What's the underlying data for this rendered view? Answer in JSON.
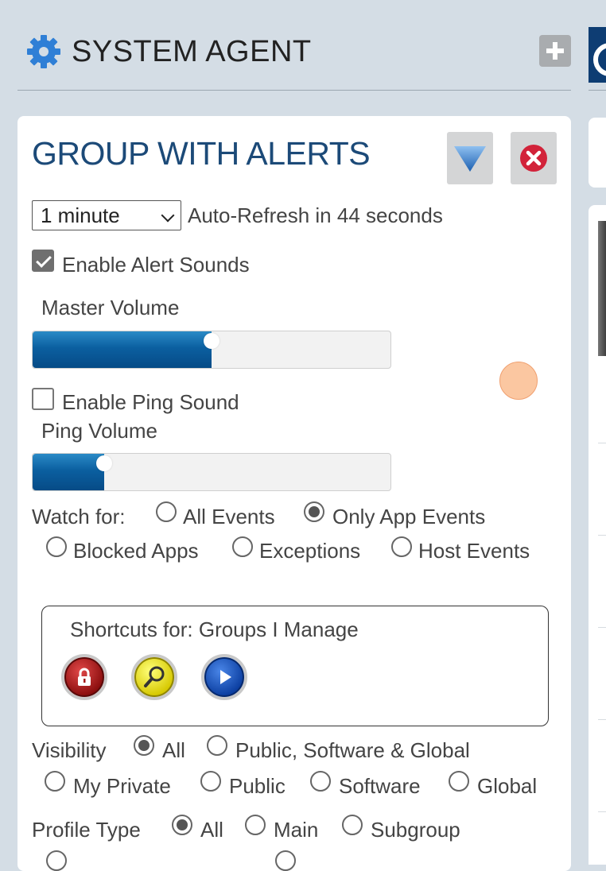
{
  "header": {
    "title": "SYSTEM AGENT",
    "add_icon": "plus-icon",
    "settings_icon": "gear-icon"
  },
  "panel": {
    "title": "GROUP WITH ALERTS",
    "filter_icon": "filter-triangle-icon",
    "close_icon": "close-circle-icon",
    "refresh": {
      "selected": "1 minute",
      "status_text": "Auto-Refresh in 44 seconds"
    },
    "alert_sounds": {
      "label": "Enable Alert Sounds",
      "checked": true
    },
    "master_volume": {
      "label": "Master Volume",
      "level_percent": 50
    },
    "ping_sound": {
      "label": "Enable Ping Sound",
      "checked": false
    },
    "ping_volume": {
      "label": "Ping Volume",
      "level_percent": 20
    },
    "watch_for": {
      "label": "Watch for:",
      "options": [
        "All Events",
        "Only App Events",
        "Blocked Apps",
        "Exceptions",
        "Host Events"
      ],
      "selected": "Only App Events"
    },
    "shortcuts": {
      "label": "Shortcuts for: Groups I Manage",
      "buttons": [
        "lock-icon",
        "search-icon",
        "play-icon"
      ]
    },
    "visibility": {
      "label": "Visibility",
      "options": [
        "All",
        "Public, Software & Global",
        "My Private",
        "Public",
        "Software",
        "Global"
      ],
      "selected": "All"
    },
    "profile_type": {
      "label": "Profile Type",
      "options": [
        "All",
        "Main",
        "Subgroup"
      ],
      "selected": "All"
    }
  },
  "colors": {
    "title": "#1c4a78",
    "slider_fill": "#0b5fa0",
    "background": "#d4dde5"
  }
}
